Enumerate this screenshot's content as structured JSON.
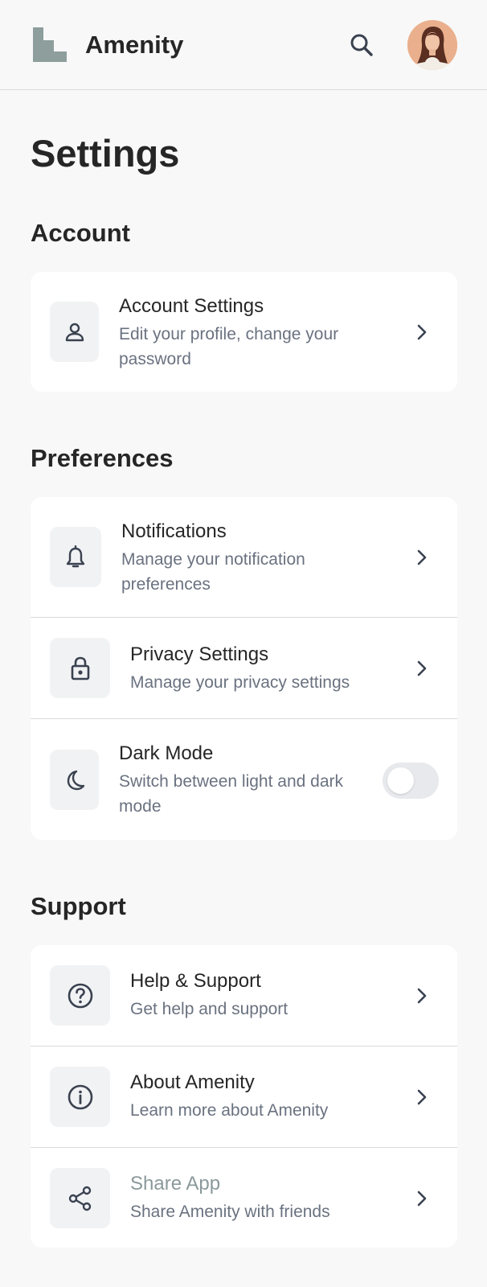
{
  "header": {
    "app_name": "Amenity",
    "logo_icon": "building-logo-icon",
    "search_icon": "search-icon",
    "avatar": "user-avatar"
  },
  "page": {
    "title": "Settings"
  },
  "sections": {
    "account": {
      "title": "Account",
      "items": [
        {
          "title": "Account Settings",
          "subtitle": "Edit your profile, change your password",
          "icon": "user-icon"
        }
      ]
    },
    "preferences": {
      "title": "Preferences",
      "items": [
        {
          "title": "Notifications",
          "subtitle": "Manage your notification preferences",
          "icon": "bell-icon"
        },
        {
          "title": "Privacy Settings",
          "subtitle": "Manage your privacy settings",
          "icon": "lock-icon"
        },
        {
          "title": "Dark Mode",
          "subtitle": "Switch between light and dark mode",
          "icon": "moon-icon",
          "toggle_on": false
        }
      ]
    },
    "support": {
      "title": "Support",
      "items": [
        {
          "title": "Help & Support",
          "subtitle": "Get help and support",
          "icon": "help-circle-icon"
        },
        {
          "title": "About Amenity",
          "subtitle": "Learn more about Amenity",
          "icon": "info-icon"
        },
        {
          "title": "Share App",
          "subtitle": "Share Amenity with friends",
          "icon": "share-icon"
        }
      ]
    }
  },
  "colors": {
    "background": "#f8f8f8",
    "card": "#ffffff",
    "icon_bg": "#f1f2f4",
    "text_primary": "#262626",
    "text_secondary": "#6a7280",
    "muted_title": "#8b999b",
    "logo": "#8d9e9c"
  }
}
